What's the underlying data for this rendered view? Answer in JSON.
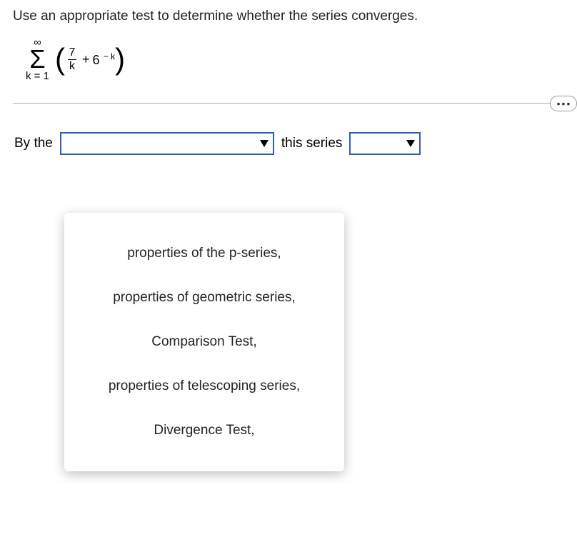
{
  "question": "Use an appropriate test to determine whether the series converges.",
  "math": {
    "sum_top": "∞",
    "sum_bottom": "k = 1",
    "sigma": "Σ",
    "frac_num": "7",
    "frac_den": "k",
    "plus": "+",
    "base": "6",
    "exp": " − k",
    "lparen": "(",
    "rparen": ")"
  },
  "ellipsis": "•••",
  "sentence": {
    "by_the": "By the",
    "this_series": "this series"
  },
  "options": [
    "properties of the p-series,",
    "properties of geometric series,",
    "Comparison Test,",
    "properties of telescoping series,",
    "Divergence Test,"
  ]
}
